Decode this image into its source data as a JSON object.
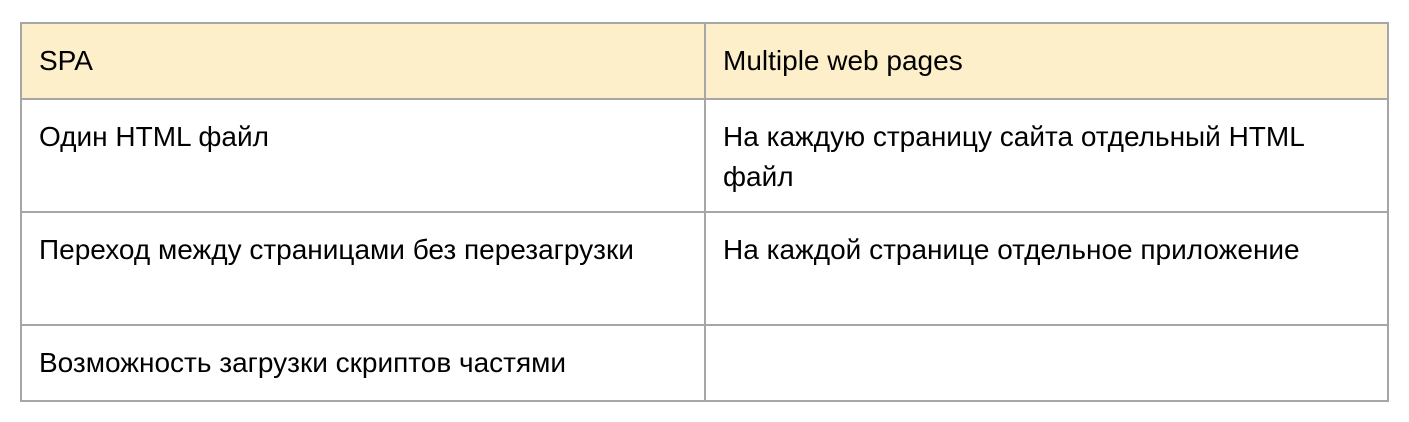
{
  "table": {
    "headers": [
      "SPA",
      "Multiple web pages"
    ],
    "rows": [
      [
        "Один HTML файл",
        "На каждую страницу сайта отдельный HTML файл"
      ],
      [
        "Переход между страницами без перезагрузки",
        "На каждой странице отдельное приложение"
      ],
      [
        "Возможность загрузки скриптов частями",
        ""
      ]
    ]
  },
  "colors": {
    "header_bg": "#fcefc9",
    "border": "#a6a6a6"
  }
}
